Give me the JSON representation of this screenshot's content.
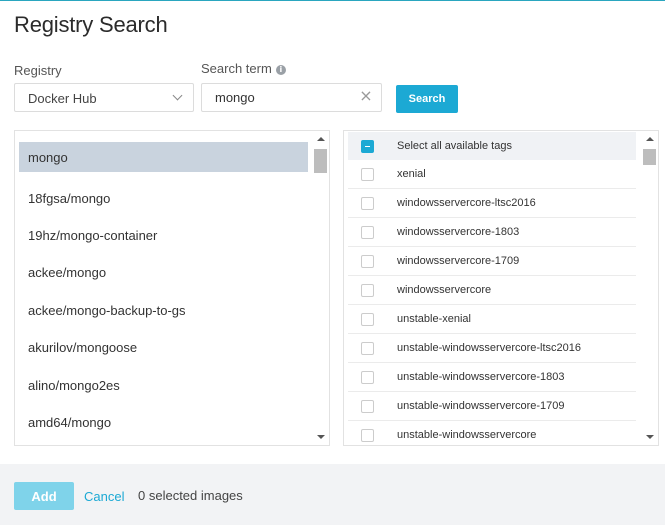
{
  "title": "Registry Search",
  "registry": {
    "label": "Registry",
    "selected": "Docker Hub"
  },
  "search": {
    "label": "Search term",
    "value": "mongo",
    "button": "Search"
  },
  "images": [
    "mongo",
    "18fgsa/mongo",
    "19hz/mongo-container",
    "ackee/mongo",
    "ackee/mongo-backup-to-gs",
    "akurilov/mongoose",
    "alino/mongo2es",
    "amd64/mongo"
  ],
  "selected_image": "mongo",
  "tags": {
    "select_all": "Select all available tags",
    "items": [
      "xenial",
      "windowsservercore-ltsc2016",
      "windowsservercore-1803",
      "windowsservercore-1709",
      "windowsservercore",
      "unstable-xenial",
      "unstable-windowsservercore-ltsc2016",
      "unstable-windowsservercore-1803",
      "unstable-windowsservercore-1709",
      "unstable-windowsservercore"
    ]
  },
  "footer": {
    "add": "Add",
    "cancel": "Cancel",
    "selected_count": "0 selected images"
  },
  "colors": {
    "accent": "#1ca9d4",
    "selected_row": "#c9d3de",
    "add_disabled": "#7fd3ea"
  },
  "icons": {
    "search_term_info": "info-icon",
    "registry_dropdown": "chevron-down-icon",
    "search_clear": "close-icon"
  }
}
